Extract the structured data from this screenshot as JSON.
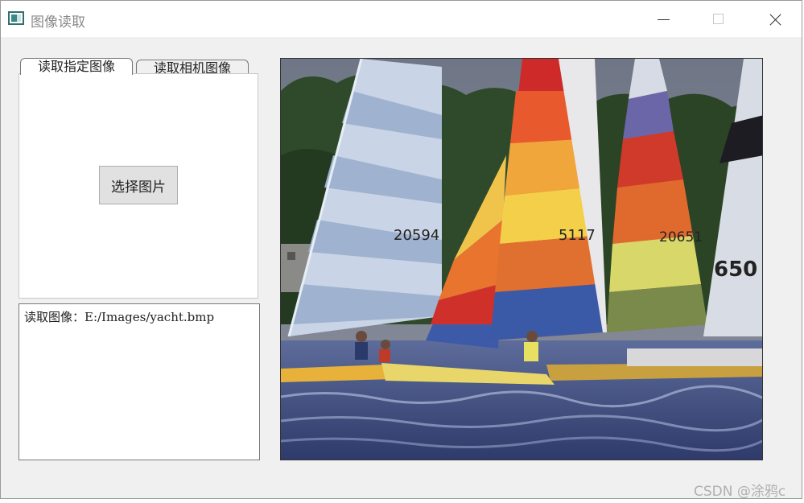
{
  "window": {
    "title": "图像读取",
    "icon": "app-window-icon",
    "controls": [
      "minimize-icon",
      "maximize-icon",
      "close-icon"
    ]
  },
  "tabs": [
    {
      "label": "读取指定图像",
      "active": true
    },
    {
      "label": "读取相机图像",
      "active": false
    }
  ],
  "panel": {
    "select_button_label": "选择图片"
  },
  "log": {
    "text": "读取图像：E:/Images/yacht.bmp"
  },
  "image_view": {
    "content": "sailboats-photo",
    "sail_numbers": [
      "20594",
      "5117",
      "20651",
      "650"
    ]
  },
  "watermark": "CSDN @涂鸦c"
}
